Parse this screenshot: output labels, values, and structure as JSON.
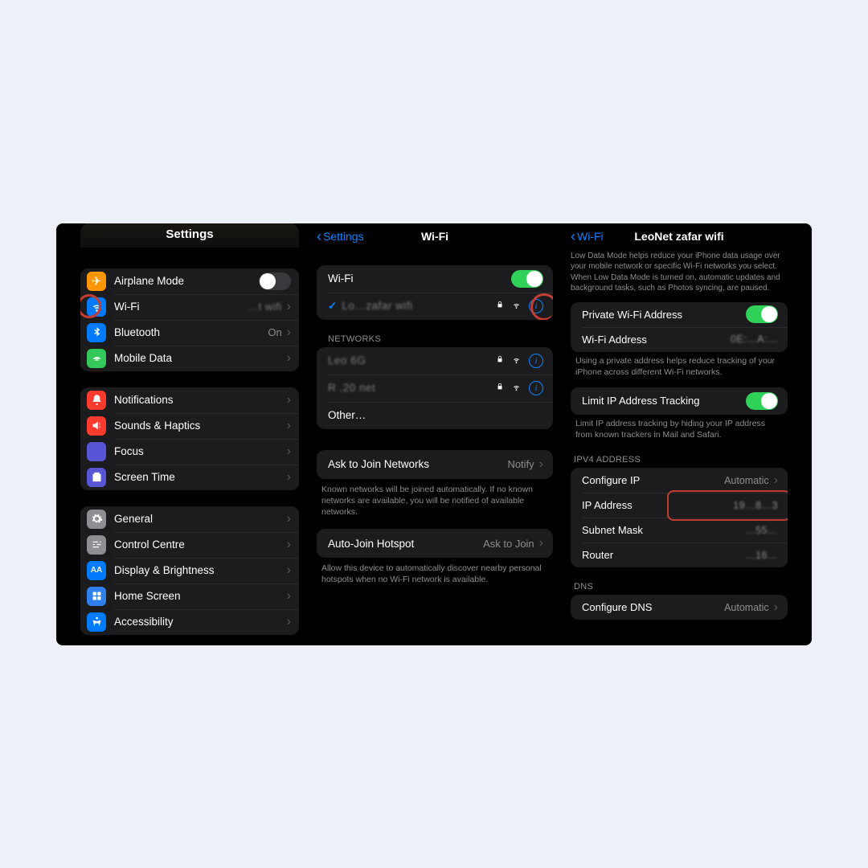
{
  "left": {
    "title": "Settings",
    "airplane": "Airplane Mode",
    "wifi": "Wi-Fi",
    "wifi_val": "…t wifi",
    "bluetooth": "Bluetooth",
    "bluetooth_val": "On",
    "mobile": "Mobile Data",
    "notifications": "Notifications",
    "sounds": "Sounds & Haptics",
    "focus": "Focus",
    "screentime": "Screen Time",
    "general": "General",
    "control": "Control Centre",
    "display": "Display & Brightness",
    "home": "Home Screen",
    "accessibility": "Accessibility"
  },
  "mid": {
    "back": "Settings",
    "title": "Wi-Fi",
    "wifi_label": "Wi-Fi",
    "connected": "Lo…zafar wifi",
    "networks_header": "NETWORKS",
    "net1": "Leo 6G",
    "net2": "R .20 net",
    "other": "Other…",
    "ask_label": "Ask to Join Networks",
    "ask_val": "Notify",
    "ask_footer": "Known networks will be joined automatically. If no known networks are available, you will be notified of available networks.",
    "auto_label": "Auto-Join Hotspot",
    "auto_val": "Ask to Join",
    "auto_footer": "Allow this device to automatically discover nearby personal hotspots when no Wi-Fi network is available."
  },
  "right": {
    "back": "Wi-Fi",
    "title": "LeoNet zafar wifi",
    "lowdata": "Low Data Mode helps reduce your iPhone data usage over your mobile network or specific Wi-Fi networks you select. When Low Data Mode is turned on, automatic updates and background tasks, such as Photos syncing, are paused.",
    "private": "Private Wi-Fi Address",
    "wifi_addr_label": "Wi-Fi Address",
    "wifi_addr_val": "0E:…A:…",
    "private_footer": "Using a private address helps reduce tracking of your iPhone across different Wi-Fi networks.",
    "limit": "Limit IP Address Tracking",
    "limit_footer": "Limit IP address tracking by hiding your IP address from known trackers in Mail and Safari.",
    "ipv4_header": "IPV4 ADDRESS",
    "config": "Configure IP",
    "config_val": "Automatic",
    "ip": "IP Address",
    "ip_val": "19…8…3",
    "subnet": "Subnet Mask",
    "subnet_val": "…55…",
    "router": "Router",
    "router_val": "…16…",
    "dns_header": "DNS",
    "dns_config": "Configure DNS",
    "dns_val": "Automatic"
  }
}
